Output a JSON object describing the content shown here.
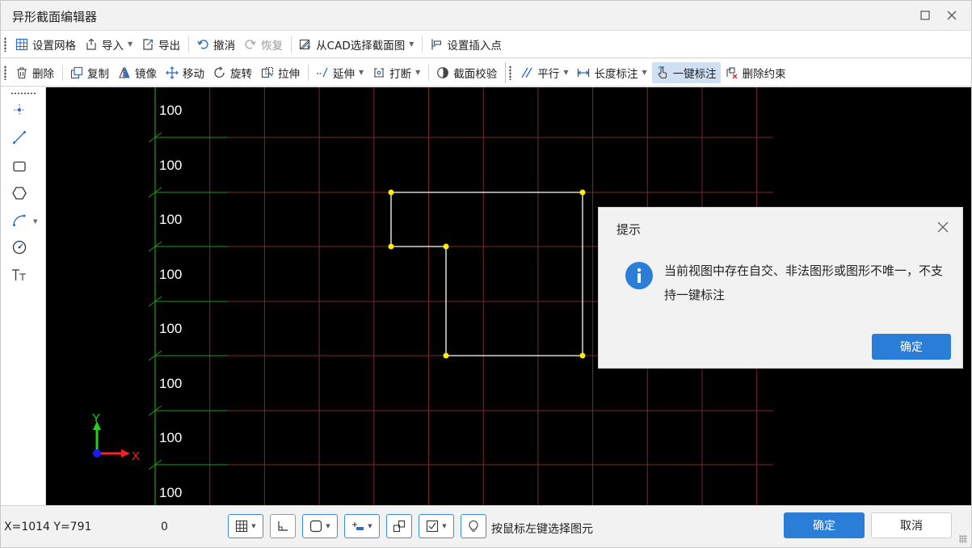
{
  "window": {
    "title": "异形截面编辑器",
    "maximize_icon": "maximize-icon",
    "close_icon": "close-icon"
  },
  "toolbar1": {
    "items": [
      {
        "label": "设置网格",
        "icon": "grid-icon"
      },
      {
        "label": "导入",
        "icon": "import-icon",
        "dropdown": true
      },
      {
        "label": "导出",
        "icon": "export-icon"
      },
      {
        "label": "撤消",
        "icon": "undo-icon"
      },
      {
        "label": "恢复",
        "icon": "redo-icon",
        "disabled": true
      },
      {
        "label": "从CAD选择截面图",
        "icon": "cad-select-icon",
        "dropdown": true
      },
      {
        "label": "设置插入点",
        "icon": "insert-point-icon"
      }
    ]
  },
  "toolbar2": {
    "items": [
      {
        "label": "删除",
        "icon": "delete-icon"
      },
      {
        "label": "复制",
        "icon": "copy-icon"
      },
      {
        "label": "镜像",
        "icon": "mirror-icon"
      },
      {
        "label": "移动",
        "icon": "move-icon"
      },
      {
        "label": "旋转",
        "icon": "rotate-icon"
      },
      {
        "label": "拉伸",
        "icon": "stretch-icon"
      },
      {
        "label": "延伸",
        "icon": "extend-icon",
        "dropdown": true
      },
      {
        "label": "打断",
        "icon": "break-icon",
        "dropdown": true
      },
      {
        "label": "截面校验",
        "icon": "section-check-icon"
      },
      {
        "label": "平行",
        "icon": "parallel-icon",
        "dropdown": true
      },
      {
        "label": "长度标注",
        "icon": "length-dimension-icon",
        "dropdown": true
      },
      {
        "label": "一键标注",
        "icon": "one-click-dimension-icon",
        "active": true
      },
      {
        "label": "删除约束",
        "icon": "delete-constraint-icon"
      }
    ]
  },
  "side_tools": [
    "point-icon",
    "line-icon",
    "rectangle-icon",
    "polygon-icon",
    "arc-icon",
    "circle-icon",
    "text-icon"
  ],
  "canvas": {
    "grid_labels": [
      "100",
      "100",
      "100",
      "100",
      "100",
      "100",
      "100",
      "100"
    ],
    "axis_x_label": "X",
    "axis_y_label": "Y",
    "colors": {
      "background": "#000000",
      "grid": "#7a2a2a",
      "ruler": "#1f9a1f",
      "shape": "#ffffff",
      "vertex": "#ffee00"
    }
  },
  "dialog": {
    "title": "提示",
    "message": "当前视图中存在自交、非法图形或图形不唯一，不支持一键标注",
    "ok_label": "确定",
    "icon": "info-icon"
  },
  "statusbar": {
    "coords": "X=1014 Y=791",
    "value": "0",
    "tools": [
      "grid-snap-icon",
      "ortho-icon",
      "object-snap-icon",
      "track-icon",
      "polar-icon",
      "dynamic-input-icon",
      "tip-icon"
    ],
    "hint": "按鼠标左键选择图元",
    "ok_label": "确定",
    "cancel_label": "取消"
  }
}
